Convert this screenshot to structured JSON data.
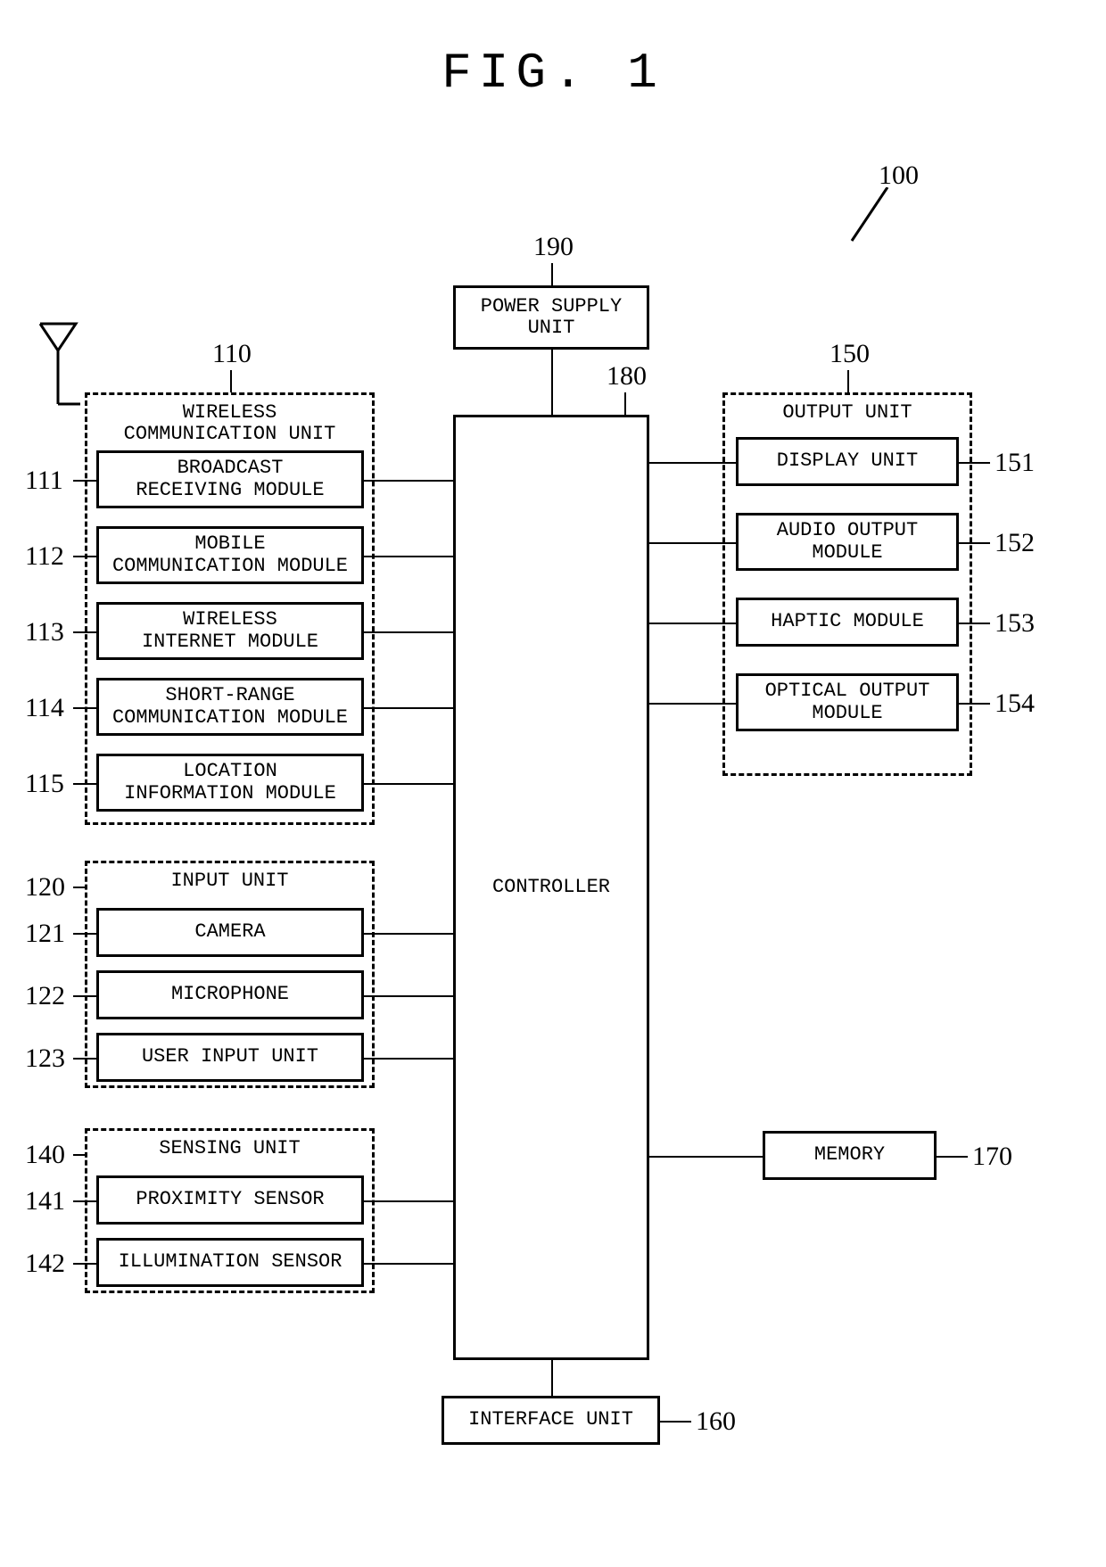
{
  "title": "FIG. 1",
  "refs": {
    "r100": "100",
    "r190": "190",
    "r180": "180",
    "r110": "110",
    "r111": "111",
    "r112": "112",
    "r113": "113",
    "r114": "114",
    "r115": "115",
    "r120": "120",
    "r121": "121",
    "r122": "122",
    "r123": "123",
    "r140": "140",
    "r141": "141",
    "r142": "142",
    "r150": "150",
    "r151": "151",
    "r152": "152",
    "r153": "153",
    "r154": "154",
    "r170": "170",
    "r160": "160"
  },
  "labels": {
    "power_supply": "POWER SUPPLY\nUNIT",
    "controller": "CONTROLLER",
    "wireless_unit": "WIRELESS\nCOMMUNICATION UNIT",
    "broadcast": "BROADCAST\nRECEIVING MODULE",
    "mobile_comm": "MOBILE\nCOMMUNICATION MODULE",
    "wireless_internet": "WIRELESS\nINTERNET MODULE",
    "short_range": "SHORT-RANGE\nCOMMUNICATION MODULE",
    "location": "LOCATION\nINFORMATION MODULE",
    "input_unit": "INPUT UNIT",
    "camera": "CAMERA",
    "microphone": "MICROPHONE",
    "user_input": "USER INPUT UNIT",
    "sensing_unit": "SENSING UNIT",
    "proximity": "PROXIMITY SENSOR",
    "illumination": "ILLUMINATION SENSOR",
    "output_unit": "OUTPUT UNIT",
    "display": "DISPLAY UNIT",
    "audio_output": "AUDIO OUTPUT\nMODULE",
    "haptic": "HAPTIC MODULE",
    "optical_output": "OPTICAL OUTPUT\nMODULE",
    "memory": "MEMORY",
    "interface": "INTERFACE UNIT"
  }
}
